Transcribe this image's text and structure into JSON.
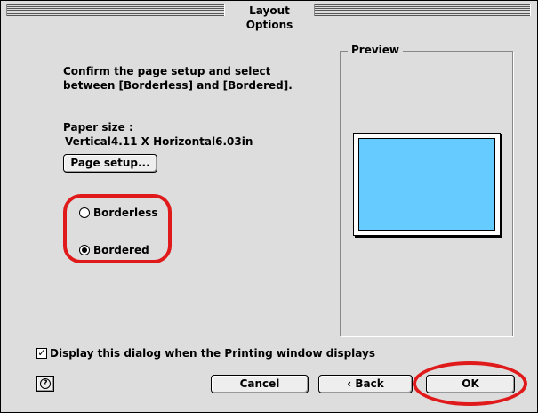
{
  "window": {
    "title": "Layout Options"
  },
  "message": "Confirm the page setup and select\nbetween [Borderless] and [Bordered].",
  "paper_size": {
    "label": "Paper size :",
    "value": "Vertical4.11 X Horizontal6.03in"
  },
  "buttons": {
    "page_setup": "Page setup...",
    "cancel": "Cancel",
    "back": "‹ Back",
    "ok": "OK"
  },
  "layout_options": [
    {
      "label": "Borderless",
      "selected": false
    },
    {
      "label": "Bordered",
      "selected": true
    }
  ],
  "preview": {
    "label": "Preview",
    "paper_color": "#ffffff",
    "print_area_color": "#66ccff"
  },
  "checkbox": {
    "label": "Display this dialog when the Printing window displays",
    "checked": true
  },
  "help": {
    "icon": "help-icon",
    "glyph": "?"
  },
  "annotation_color": "#e01a1a"
}
